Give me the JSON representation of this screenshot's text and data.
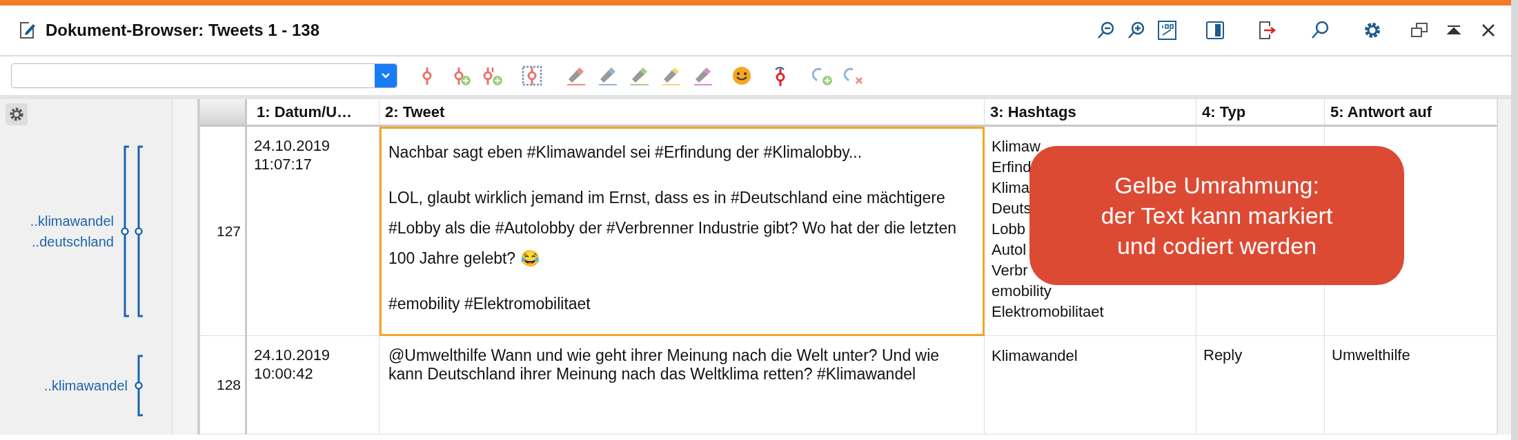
{
  "window": {
    "title": "Dokument-Browser: Tweets 1 - 138"
  },
  "toolbar": {
    "pens": [
      {
        "color": "#f08a80"
      },
      {
        "color": "#8fb4d8"
      },
      {
        "color": "#9fd080"
      },
      {
        "color": "#f7d870"
      },
      {
        "color": "#d88ad8"
      }
    ]
  },
  "table": {
    "columns": [
      "1: Datum/U…",
      "2: Tweet",
      "3: Hashtags",
      "4: Typ",
      "5: Antwort auf"
    ],
    "rows": [
      {
        "number": "127",
        "codes": [
          {
            "label": "..klimawandel"
          },
          {
            "label": "..deutschland"
          }
        ],
        "datum": [
          "24.10.2019",
          "11:07:17"
        ],
        "focused": true,
        "tweet": [
          "Nachbar sagt eben #Klimawandel sei #Erfindung der #Klimalobby...",
          "LOL, glaubt wirklich jemand im Ernst, dass es in #Deutschland eine mächtigere #Lobby als die #Autolobby der #Verbrenner Industrie gibt? Wo hat der die letzten 100 Jahre gelebt? 😂",
          "#emobility #Elektromobilitaet"
        ],
        "hashtags": [
          "Klimaw",
          "Erfind",
          "Klima",
          "Deuts",
          "Lobb",
          "Autol",
          "Verbr",
          "emobility",
          "Elektromobilitaet"
        ],
        "typ": "",
        "antwort": ""
      },
      {
        "number": "128",
        "codes": [
          {
            "label": "..klimawandel"
          }
        ],
        "datum": [
          "24.10.2019",
          "10:00:42"
        ],
        "focused": false,
        "tweet": [
          "@Umwelthilfe Wann und wie geht ihrer Meinung nach die Welt unter? Und wie kann Deutschland ihrer Meinung nach das Weltklima retten? #Klimawandel"
        ],
        "hashtags": [
          "Klimawandel"
        ],
        "typ": "Reply",
        "antwort": "Umwelthilfe"
      }
    ]
  },
  "callout": {
    "lines": [
      "Gelbe Umrahmung:",
      "der Text kann markiert",
      "und codiert werden"
    ]
  }
}
